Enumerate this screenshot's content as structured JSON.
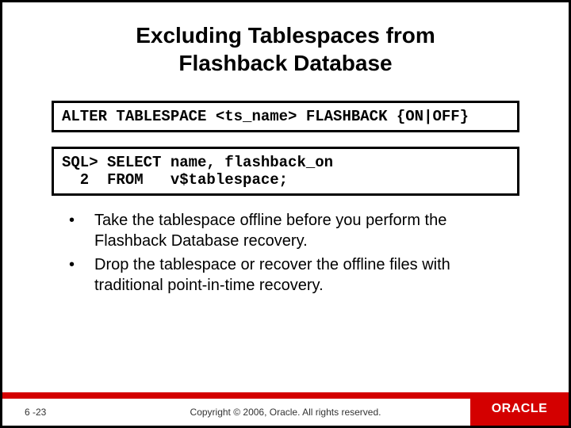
{
  "title_line1": "Excluding Tablespaces from",
  "title_line2": "Flashback Database",
  "codebox1": "ALTER TABLESPACE <ts_name> FLASHBACK {ON|OFF}",
  "codebox2": "SQL> SELECT name, flashback_on\n  2  FROM   v$tablespace;",
  "bullets": [
    "Take the tablespace offline before you perform the Flashback Database recovery.",
    "Drop the tablespace or recover the offline files with traditional point-in-time recovery."
  ],
  "footer": {
    "page": "6 -23",
    "copyright": "Copyright © 2006, Oracle. All rights reserved.",
    "logo": "ORACLE"
  }
}
